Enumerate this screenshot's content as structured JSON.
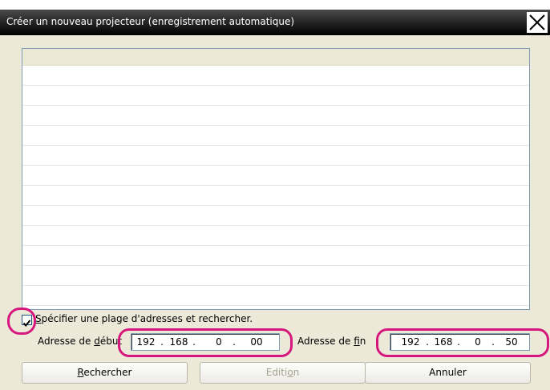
{
  "window": {
    "title": "Créer un nouveau projecteur (enregistrement automatique)"
  },
  "list": {
    "rows": 13
  },
  "range": {
    "checked": true,
    "checkbox_label_first": "S",
    "checkbox_label_rest": "pécifier une plage d'adresses et rechercher.",
    "start_label_a": "Adresse de ",
    "start_label_u": "d",
    "start_label_b": "ébut",
    "start_ip": [
      "192",
      "168",
      "0",
      "00"
    ],
    "end_label_a": "Adresse de ",
    "end_label_u": "f",
    "end_label_b": "in",
    "end_ip": [
      "192",
      "168",
      "0",
      "50"
    ],
    "separator": "."
  },
  "buttons": {
    "search_u": "R",
    "search_rest": "echercher",
    "edit_a": "Editi",
    "edit_u": "o",
    "edit_b": "n",
    "cancel": "Annuler"
  },
  "colors": {
    "highlight": "#d6177d",
    "titlebar": "#000000"
  }
}
